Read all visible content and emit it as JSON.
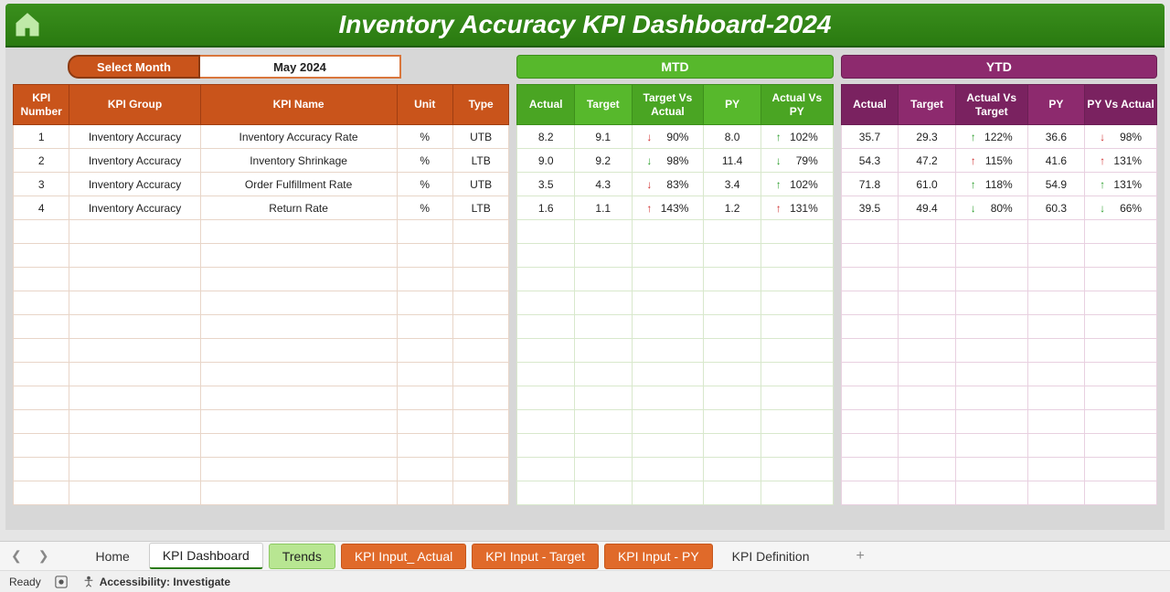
{
  "header": {
    "title": "Inventory Accuracy KPI Dashboard-2024"
  },
  "month_selector": {
    "label": "Select Month",
    "value": "May 2024"
  },
  "bands": {
    "mtd": "MTD",
    "ytd": "YTD"
  },
  "columns": {
    "left": [
      "KPI Number",
      "KPI Group",
      "KPI Name",
      "Unit",
      "Type"
    ],
    "mtd": [
      "Actual",
      "Target",
      "Target Vs Actual",
      "PY",
      "Actual Vs PY"
    ],
    "ytd": [
      "Actual",
      "Target",
      "Actual Vs Target",
      "PY",
      "PY Vs Actual"
    ]
  },
  "rows": [
    {
      "num": "1",
      "group": "Inventory Accuracy",
      "name": "Inventory Accuracy Rate",
      "unit": "%",
      "type": "UTB",
      "mtd": {
        "actual": "8.2",
        "target": "9.1",
        "tva": {
          "dir": "down-red",
          "val": "90%"
        },
        "py": "8.0",
        "avpy": {
          "dir": "up-green",
          "val": "102%"
        }
      },
      "ytd": {
        "actual": "35.7",
        "target": "29.3",
        "avt": {
          "dir": "up-green",
          "val": "122%"
        },
        "py": "36.6",
        "pva": {
          "dir": "down-red",
          "val": "98%"
        }
      }
    },
    {
      "num": "2",
      "group": "Inventory Accuracy",
      "name": "Inventory Shrinkage",
      "unit": "%",
      "type": "LTB",
      "mtd": {
        "actual": "9.0",
        "target": "9.2",
        "tva": {
          "dir": "down-green",
          "val": "98%"
        },
        "py": "11.4",
        "avpy": {
          "dir": "down-green",
          "val": "79%"
        }
      },
      "ytd": {
        "actual": "54.3",
        "target": "47.2",
        "avt": {
          "dir": "up-red",
          "val": "115%"
        },
        "py": "41.6",
        "pva": {
          "dir": "up-red",
          "val": "131%"
        }
      }
    },
    {
      "num": "3",
      "group": "Inventory Accuracy",
      "name": "Order Fulfillment Rate",
      "unit": "%",
      "type": "UTB",
      "mtd": {
        "actual": "3.5",
        "target": "4.3",
        "tva": {
          "dir": "down-red",
          "val": "83%"
        },
        "py": "3.4",
        "avpy": {
          "dir": "up-green",
          "val": "102%"
        }
      },
      "ytd": {
        "actual": "71.8",
        "target": "61.0",
        "avt": {
          "dir": "up-green",
          "val": "118%"
        },
        "py": "54.9",
        "pva": {
          "dir": "up-green",
          "val": "131%"
        }
      }
    },
    {
      "num": "4",
      "group": "Inventory Accuracy",
      "name": "Return Rate",
      "unit": "%",
      "type": "LTB",
      "mtd": {
        "actual": "1.6",
        "target": "1.1",
        "tva": {
          "dir": "up-red",
          "val": "143%"
        },
        "py": "1.2",
        "avpy": {
          "dir": "up-red",
          "val": "131%"
        }
      },
      "ytd": {
        "actual": "39.5",
        "target": "49.4",
        "avt": {
          "dir": "down-green",
          "val": "80%"
        },
        "py": "60.3",
        "pva": {
          "dir": "down-green",
          "val": "66%"
        }
      }
    }
  ],
  "tabs": {
    "home": "Home",
    "active": "KPI Dashboard",
    "trends": "Trends",
    "inp_actual": "KPI Input_ Actual",
    "inp_target": "KPI Input - Target",
    "inp_py": "KPI Input - PY",
    "def": "KPI Definition"
  },
  "status": {
    "ready": "Ready",
    "accessibility": "Accessibility: Investigate"
  }
}
